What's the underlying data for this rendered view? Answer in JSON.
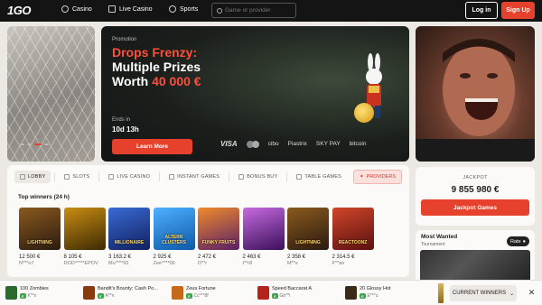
{
  "header": {
    "logo_num": "1",
    "logo_text": "GO",
    "nav": [
      {
        "label": "Casino",
        "icon": "casino-chip-icon"
      },
      {
        "label": "Live Casino",
        "icon": "tv-icon"
      },
      {
        "label": "Sports",
        "icon": "ball-icon"
      }
    ],
    "search_placeholder": "Game or provider",
    "login_label": "Log in",
    "signup_label": "Sign Up"
  },
  "promo": {
    "label": "Promotion",
    "title_red": "Drops Frenzy:",
    "title_line2": "Multiple Prizes",
    "title_line3_white": "Worth ",
    "title_line3_red": "40 000 €",
    "ends_label": "Ends in",
    "countdown": "10d 13h",
    "cta": "Learn More",
    "payments": [
      "VISA",
      "",
      "cibo",
      "Piastrix",
      "SKY PAY",
      "bitcoin"
    ]
  },
  "lobby": {
    "tabs": [
      {
        "label": "LOBBY",
        "active": true
      },
      {
        "label": "SLOTS"
      },
      {
        "label": "LIVE CASINO"
      },
      {
        "label": "INSTANT GAMES"
      },
      {
        "label": "BONUS BUY"
      },
      {
        "label": "TABLE GAMES"
      }
    ],
    "providers_label": "PROVIDERS",
    "section_title": "Top winners (24 h)",
    "games": [
      {
        "amount": "12 500 €",
        "user": "N***o7",
        "art": "LIGHTNING",
        "c1": "#2b1a10",
        "c2": "#8a5a1e"
      },
      {
        "amount": "8 105 €",
        "user": "DOD*****EPOV",
        "art": "",
        "c1": "#3d2a05",
        "c2": "#c98d12"
      },
      {
        "amount": "3 163.2 €",
        "user": "Mu****93",
        "art": "MILLIONAIRE",
        "c1": "#102060",
        "c2": "#3a6bd4"
      },
      {
        "amount": "2 925 €",
        "user": "Zee****06",
        "art": "ALTERN CLUSTERS",
        "c1": "#0d5aa8",
        "c2": "#4fb0ff"
      },
      {
        "amount": "2 472 €",
        "user": "D**r",
        "art": "FUNKY FRUITS",
        "c1": "#5a1f66",
        "c2": "#f08a2c"
      },
      {
        "amount": "2 463 €",
        "user": "t**r8",
        "art": "",
        "c1": "#3a105a",
        "c2": "#c76be0"
      },
      {
        "amount": "2 358 €",
        "user": "M**s",
        "art": "LIGHTNING",
        "c1": "#2b1a10",
        "c2": "#8a5a1e"
      },
      {
        "amount": "2 314.5 €",
        "user": "F**an",
        "art": "REACTOONZ",
        "c1": "#5a1010",
        "c2": "#d0462a"
      }
    ]
  },
  "jackpot": {
    "label": "JACKPOT",
    "value": "9 855 980 €",
    "cta": "Jackpot Games"
  },
  "most_wanted": {
    "title": "Most Wanted",
    "subtitle": "Tournament",
    "rate_label": "Rate"
  },
  "ticker": {
    "items": [
      {
        "name": "100 Zombies",
        "badge": "€",
        "user": "K**s",
        "color": "#2d6a2e"
      },
      {
        "name": "Bandit's Bounty: Cash Po...",
        "badge": "€",
        "user": "A**n",
        "color": "#8a3a10"
      },
      {
        "name": "Zeus Fortune",
        "badge": "€",
        "user": "Cc***8f",
        "color": "#c46a1a"
      },
      {
        "name": "Speed Baccarat A",
        "badge": "€",
        "user": "Gb**l",
        "color": "#b4241a"
      },
      {
        "name": "20 Glossy Hot",
        "badge": "€",
        "user": "E***u",
        "color": "#3a2a1a"
      }
    ],
    "toggle_label": "CURRENT WINNERS",
    "close": "✕"
  }
}
